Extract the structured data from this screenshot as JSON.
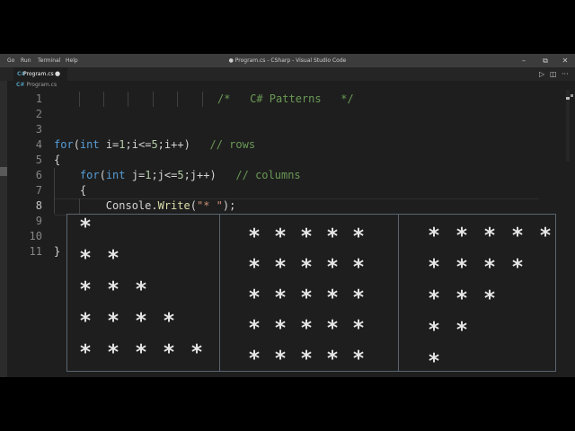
{
  "window": {
    "title": "● Program.cs - CSharp - Visual Studio Code"
  },
  "menu": [
    "Go",
    "Run",
    "Terminal",
    "Help"
  ],
  "window_controls": {
    "minimize": "–",
    "restore": "⧉",
    "close": "✕"
  },
  "tab": {
    "label": "Program.cs",
    "icon": "C#",
    "dirty_indicator": "●"
  },
  "toolbar": {
    "run_icon": "▷",
    "split_icon": "◫",
    "more_icon": "···"
  },
  "breadcrumb": {
    "icon": "C#",
    "label": "Program.cs"
  },
  "editor": {
    "line_numbers": [
      "1",
      "2",
      "3",
      "4",
      "5",
      "6",
      "7",
      "8",
      "9",
      "10",
      "11"
    ],
    "active_line": "8",
    "lines": {
      "l1": {
        "comment": "/*   C# Patterns   */"
      },
      "l4": {
        "kw_for": "for",
        "paren_open": "(",
        "kw_int": "int",
        "var_i": " i=",
        "n1": "1",
        "cond_mid": ";i<=",
        "n5": "5",
        "cond_end": ";i++)",
        "gap": "   ",
        "comment": "// rows"
      },
      "l5": {
        "brace": "{"
      },
      "l6": {
        "indent": "    ",
        "kw_for": "for",
        "paren_open": "(",
        "kw_int": "int",
        "var_j": " j=",
        "n1": "1",
        "cond_mid": ";j<=",
        "n5": "5",
        "cond_end": ";j++)",
        "gap": "   ",
        "comment": "// columns"
      },
      "l7": {
        "indent": "    ",
        "brace": "{"
      },
      "l8": {
        "indent": "        ",
        "obj": "Console",
        "dot": ".",
        "method": "Write",
        "paren_open": "(",
        "str": "\"* \"",
        "paren_close": ")",
        "semi": ";"
      },
      "l11": {
        "brace": "}"
      }
    }
  },
  "patterns": {
    "glyph": "*",
    "left_rows": [
      1,
      2,
      3,
      4,
      5
    ],
    "middle_rows": [
      5,
      5,
      5,
      5,
      5
    ],
    "right_rows": [
      5,
      4,
      3,
      2,
      1
    ]
  }
}
